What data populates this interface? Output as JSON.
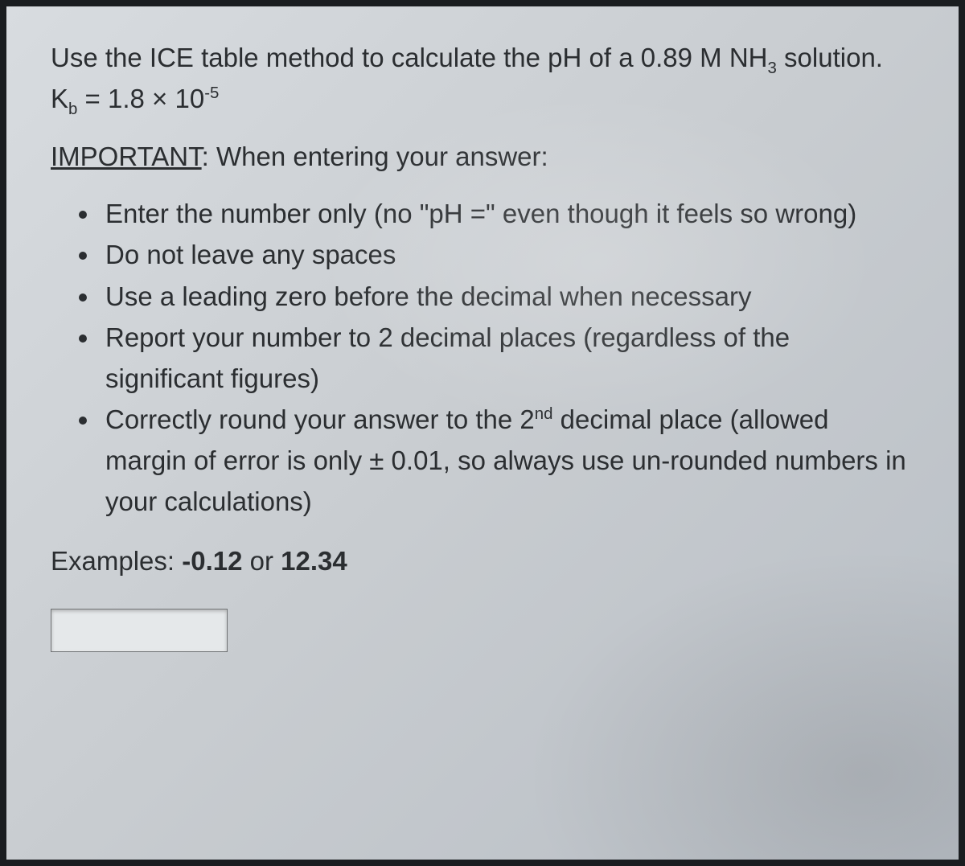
{
  "question": {
    "prefix": "Use the ICE table method to calculate the pH of a ",
    "concentration": "0.89",
    "unit": "M",
    "species_base": "NH",
    "species_sub": "3",
    "suffix1": " solution.  K",
    "kb_sub": "b",
    "equals": " = ",
    "kb_mantissa": "1.8",
    "times": " × ",
    "ten": "10",
    "kb_exp": "-5"
  },
  "important": {
    "label": "IMPORTANT",
    "colon_space": ":  ",
    "rest": "When entering your answer:"
  },
  "bullets": [
    {
      "text": "Enter the number only (no \"pH =\" even though it feels so wrong)"
    },
    {
      "text": "Do not leave any spaces"
    },
    {
      "text": "Use a leading zero before the decimal when necessary"
    },
    {
      "text": "Report your number to 2 decimal places (regardless of the significant figures)"
    },
    {
      "pre": "Correctly round your answer to the 2",
      "sup": "nd",
      "post": " decimal place (allowed margin of error is only ± 0.01, so always use un-rounded numbers in your calculations)"
    }
  ],
  "examples": {
    "label": "Examples:  ",
    "ex1": "-0.12",
    "or": "  or  ",
    "ex2": "12.34"
  },
  "input": {
    "value": ""
  }
}
